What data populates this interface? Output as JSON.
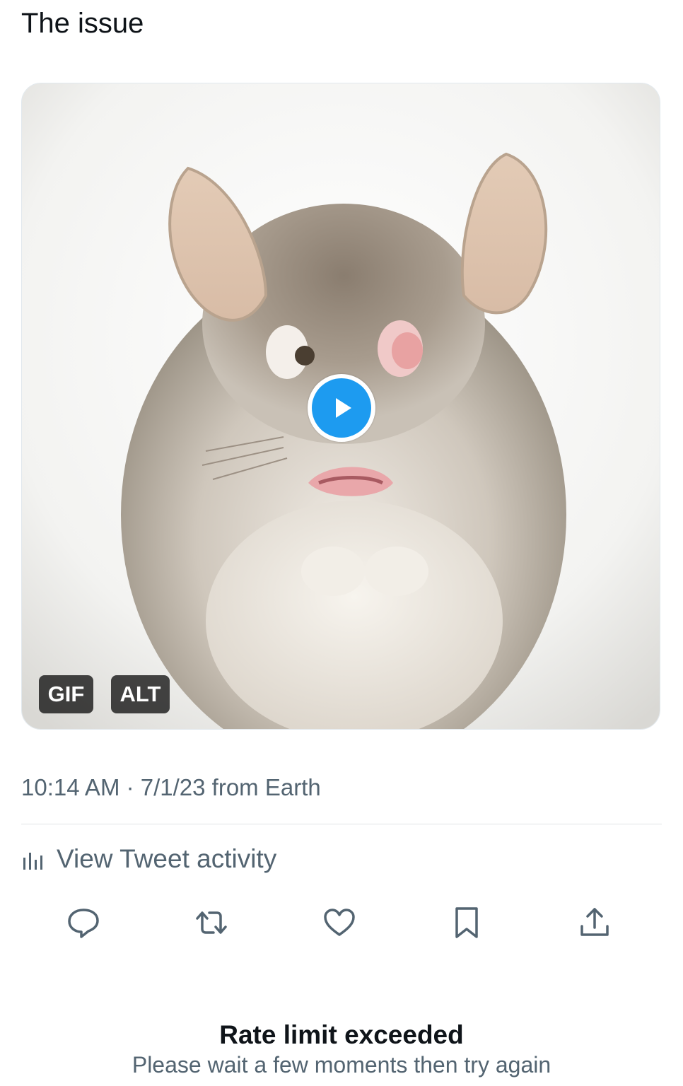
{
  "tweet": {
    "text": "The issue",
    "timestamp": "10:14 AM · 7/1/23 from Earth"
  },
  "media": {
    "badges": {
      "gif": "GIF",
      "alt": "ALT"
    },
    "play_icon": "play-icon",
    "accent_color": "#1d9bf0"
  },
  "activity": {
    "label": "View Tweet activity",
    "icon": "bar-chart-icon"
  },
  "actions": [
    {
      "name": "reply",
      "icon": "speech-bubble-icon"
    },
    {
      "name": "retweet",
      "icon": "retweet-arrows-icon"
    },
    {
      "name": "like",
      "icon": "heart-icon"
    },
    {
      "name": "bookmark",
      "icon": "bookmark-icon"
    },
    {
      "name": "share",
      "icon": "share-upload-icon"
    }
  ],
  "notice": {
    "title": "Rate limit exceeded",
    "message": "Please wait a few moments then try again"
  },
  "colors": {
    "text_primary": "#0f1419",
    "text_secondary": "#536471"
  }
}
